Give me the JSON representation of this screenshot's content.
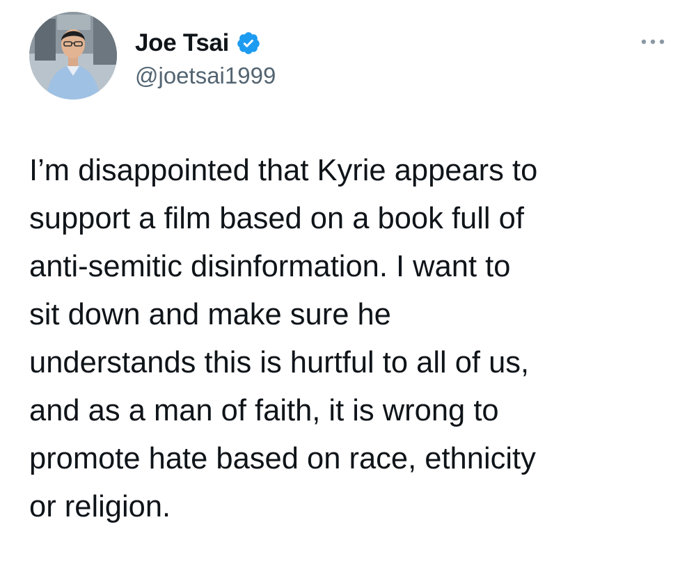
{
  "author": {
    "display_name": "Joe Tsai",
    "handle": "@joetsai1999",
    "verified": true,
    "avatar_icon": "profile-photo",
    "verified_icon": "verified-badge-icon",
    "verified_color": "#1d9bf0"
  },
  "menu": {
    "icon": "more-options-icon"
  },
  "tweet": {
    "lines": [
      "I’m disappointed that Kyrie appears to",
      "support a film based on a book full of",
      "anti-semitic disinformation. I want to",
      "sit down and make sure he",
      "understands this is hurtful to all of us,",
      "and as a man of faith, it is wrong to",
      "promote hate based on race, ethnicity",
      "or religion."
    ]
  }
}
